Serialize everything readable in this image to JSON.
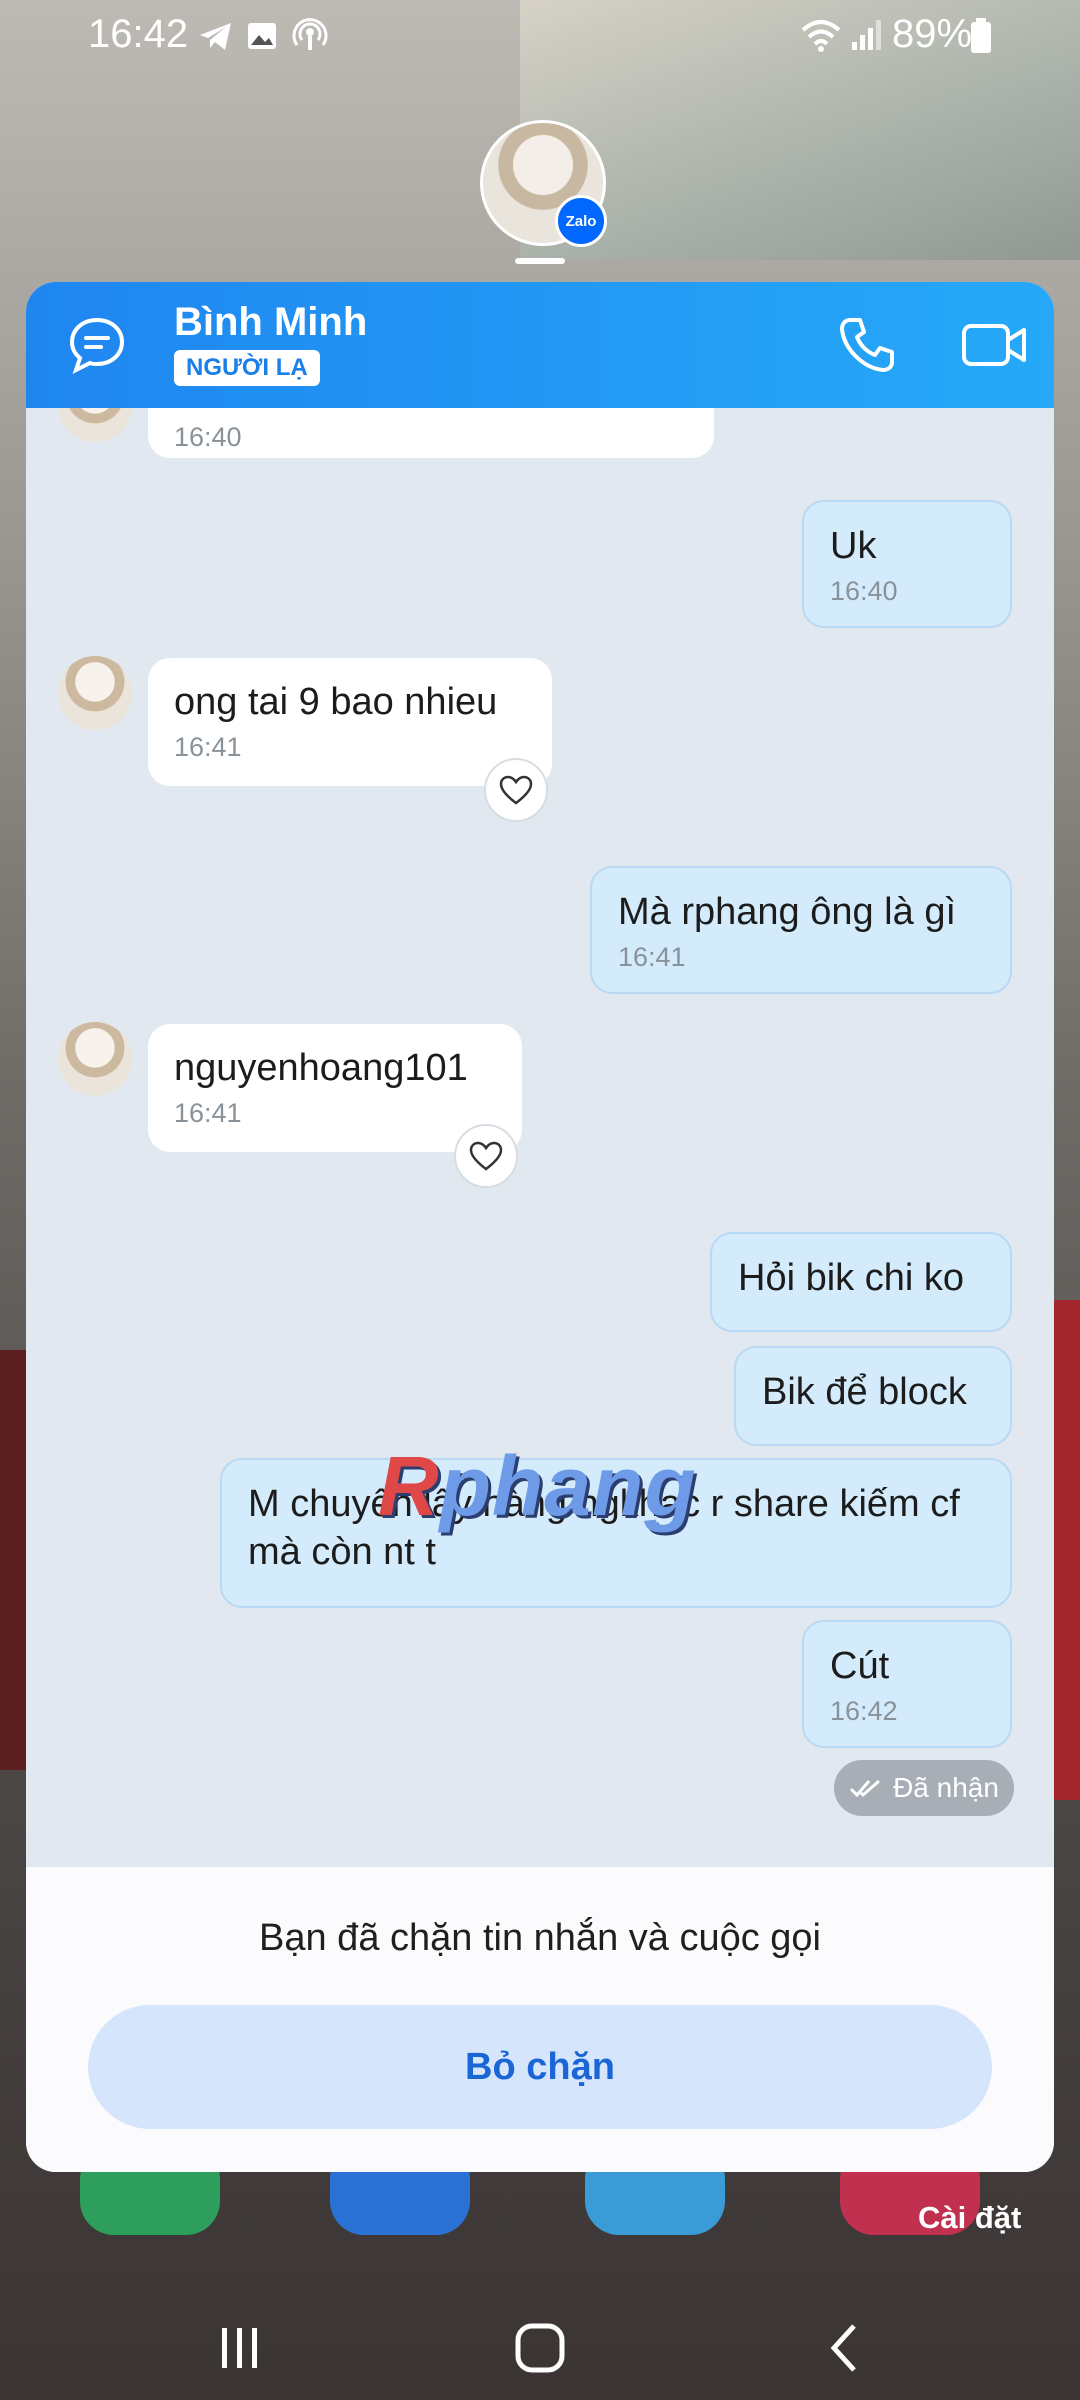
{
  "status_bar": {
    "time": "16:42",
    "battery_text": "89%",
    "icons": [
      "telegram-icon",
      "image-icon",
      "hotspot-icon",
      "wifi-icon",
      "signal-icon",
      "battery-icon"
    ]
  },
  "chat_head": {
    "badge": "Zalo"
  },
  "header": {
    "name": "Bình Minh",
    "badge": "NGƯỜI LẠ"
  },
  "messages": [
    {
      "dir": "in",
      "text": "",
      "time": "16:40"
    },
    {
      "dir": "out",
      "text": "Uk",
      "time": "16:40"
    },
    {
      "dir": "in",
      "text": "ong tai 9 bao nhieu",
      "time": "16:41"
    },
    {
      "dir": "out",
      "text": "Mà rphang ông là gì",
      "time": "16:41"
    },
    {
      "dir": "in",
      "text": "nguyenhoang101",
      "time": "16:41"
    },
    {
      "dir": "out",
      "text": "Hỏi bik chi ko",
      "time": ""
    },
    {
      "dir": "out",
      "text": "Bik để block",
      "time": ""
    },
    {
      "dir": "out",
      "text": "M chuyên lấy hàng ngkhac r share kiếm cf mà còn nt t",
      "time": ""
    },
    {
      "dir": "out",
      "text": "Cút",
      "time": "16:42"
    }
  ],
  "seen_status": "Đã nhận",
  "watermark": {
    "first": "R",
    "rest": "phang"
  },
  "footer": {
    "notice": "Bạn đã chặn tin nhắn và cuộc gọi",
    "unblock_label": "Bỏ chặn"
  },
  "settings_label": "Cài đặt",
  "colors": {
    "header_start": "#1f86f0",
    "header_end": "#26a9f8",
    "accent": "#1a66d6",
    "out_bubble": "#d4ebfc"
  }
}
